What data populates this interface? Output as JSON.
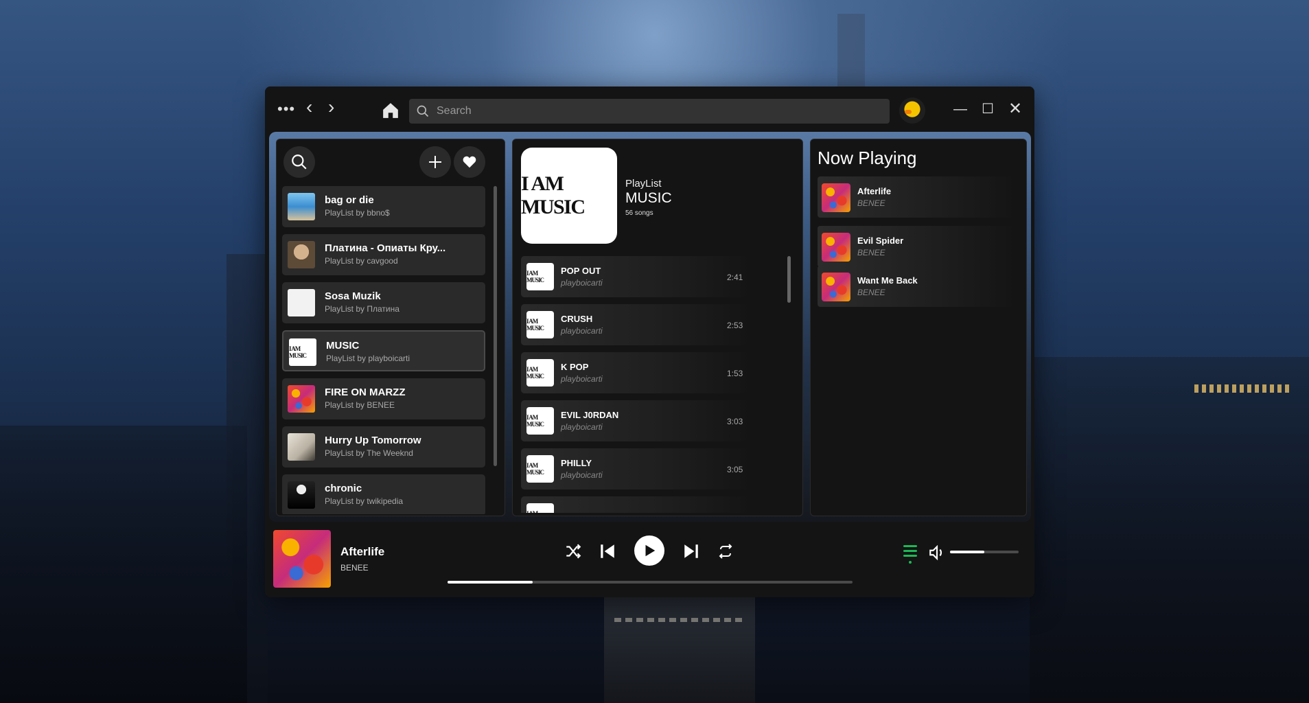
{
  "titlebar": {
    "more_label": "•••",
    "back_label": "‹",
    "forward_label": "›",
    "search_placeholder": "Search",
    "minimize_label": "—",
    "maximize_label": "☐",
    "close_label": "✕"
  },
  "library": {
    "items": [
      {
        "title": "bag or die",
        "subtitle": "PlayList by  bbno$",
        "cover": "cov-blue"
      },
      {
        "title": "Платина - Опиаты Кру...",
        "subtitle": "PlayList by  cavgood",
        "cover": "cov-face"
      },
      {
        "title": "Sosa Muzik",
        "subtitle": "PlayList by  Платина",
        "cover": "cov-white"
      },
      {
        "title": "MUSIC",
        "subtitle": "PlayList by  playboicarti",
        "cover": "cov-music",
        "active": true
      },
      {
        "title": "FIRE ON MARZZ",
        "subtitle": "PlayList by  BENEE",
        "cover": "cov-fire"
      },
      {
        "title": "Hurry Up Tomorrow",
        "subtitle": "PlayList by  The Weeknd",
        "cover": "cov-hurry"
      },
      {
        "title": "chronic",
        "subtitle": "PlayList by  twikipedia",
        "cover": "cov-chronic"
      }
    ]
  },
  "playlist": {
    "cover_text": "I AM MUSIC",
    "type": "PlayList",
    "name": "MUSIC",
    "count": "56 songs",
    "tracks": [
      {
        "title": "POP OUT",
        "artist": "playboicarti",
        "duration": "2:41"
      },
      {
        "title": "CRUSH",
        "artist": "playboicarti",
        "duration": "2:53"
      },
      {
        "title": "K POP",
        "artist": "playboicarti",
        "duration": "1:53"
      },
      {
        "title": "EVIL J0RDAN",
        "artist": "playboicarti",
        "duration": "3:03"
      },
      {
        "title": "PHILLY",
        "artist": "playboicarti",
        "duration": "3:05"
      },
      {
        "title": "",
        "artist": "",
        "duration": ""
      }
    ]
  },
  "now_playing": {
    "heading": "Now Playing",
    "items": [
      {
        "title": "Afterlife",
        "artist": "BENEE"
      },
      {
        "title": "Evil Spider",
        "artist": "BENEE"
      },
      {
        "title": "Want Me Back",
        "artist": "BENEE"
      }
    ]
  },
  "player": {
    "song": "Afterlife",
    "artist": "BENEE",
    "progress": 0.21,
    "volume": 0.5
  },
  "colors": {
    "accent": "#1db954",
    "panel": "#141414",
    "item": "#2a2a2a"
  }
}
